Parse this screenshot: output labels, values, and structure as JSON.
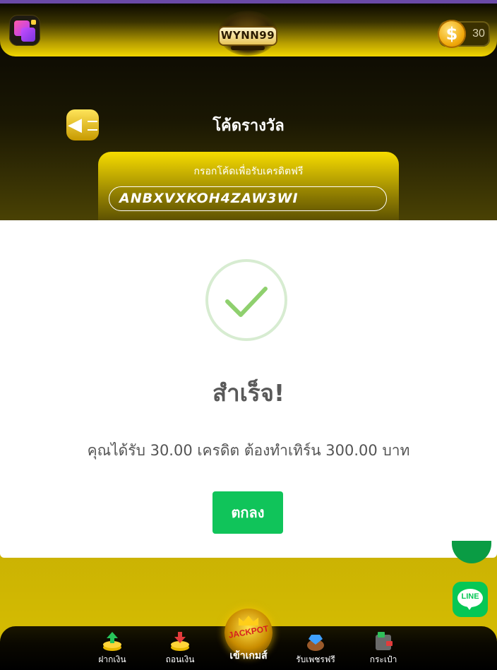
{
  "header": {
    "logo_text": "WYNN99",
    "coin_symbol": "$",
    "coin_balance": "30"
  },
  "page": {
    "title": "โค้ดรางวัล",
    "code_label": "กรอกโค้ดเพื่อรับเครดิตฟรี",
    "code_value": "ANBXVXKOH4ZAW3WI"
  },
  "modal": {
    "title": "สำเร็จ!",
    "message": "คุณได้รับ 30.00 เครดิต ต้องทำเทิร์น 300.00 บาท",
    "ok_label": "ตกลง"
  },
  "floating": {
    "line_label": "LINE"
  },
  "bottom_nav": {
    "items": [
      {
        "label": "ฝากเงิน",
        "icon": "deposit-icon"
      },
      {
        "label": "ถอนเงิน",
        "icon": "withdraw-icon"
      },
      {
        "label": "เข้าเกมส์",
        "icon": "jackpot-icon",
        "badge": "JACKPOT"
      },
      {
        "label": "รับเพชรฟรี",
        "icon": "diamond-bag-icon"
      },
      {
        "label": "กระเป๋า",
        "icon": "wallet-icon"
      }
    ]
  },
  "colors": {
    "accent_yellow": "#f2d600",
    "success_green": "#10c45a",
    "line_green": "#06c755"
  }
}
